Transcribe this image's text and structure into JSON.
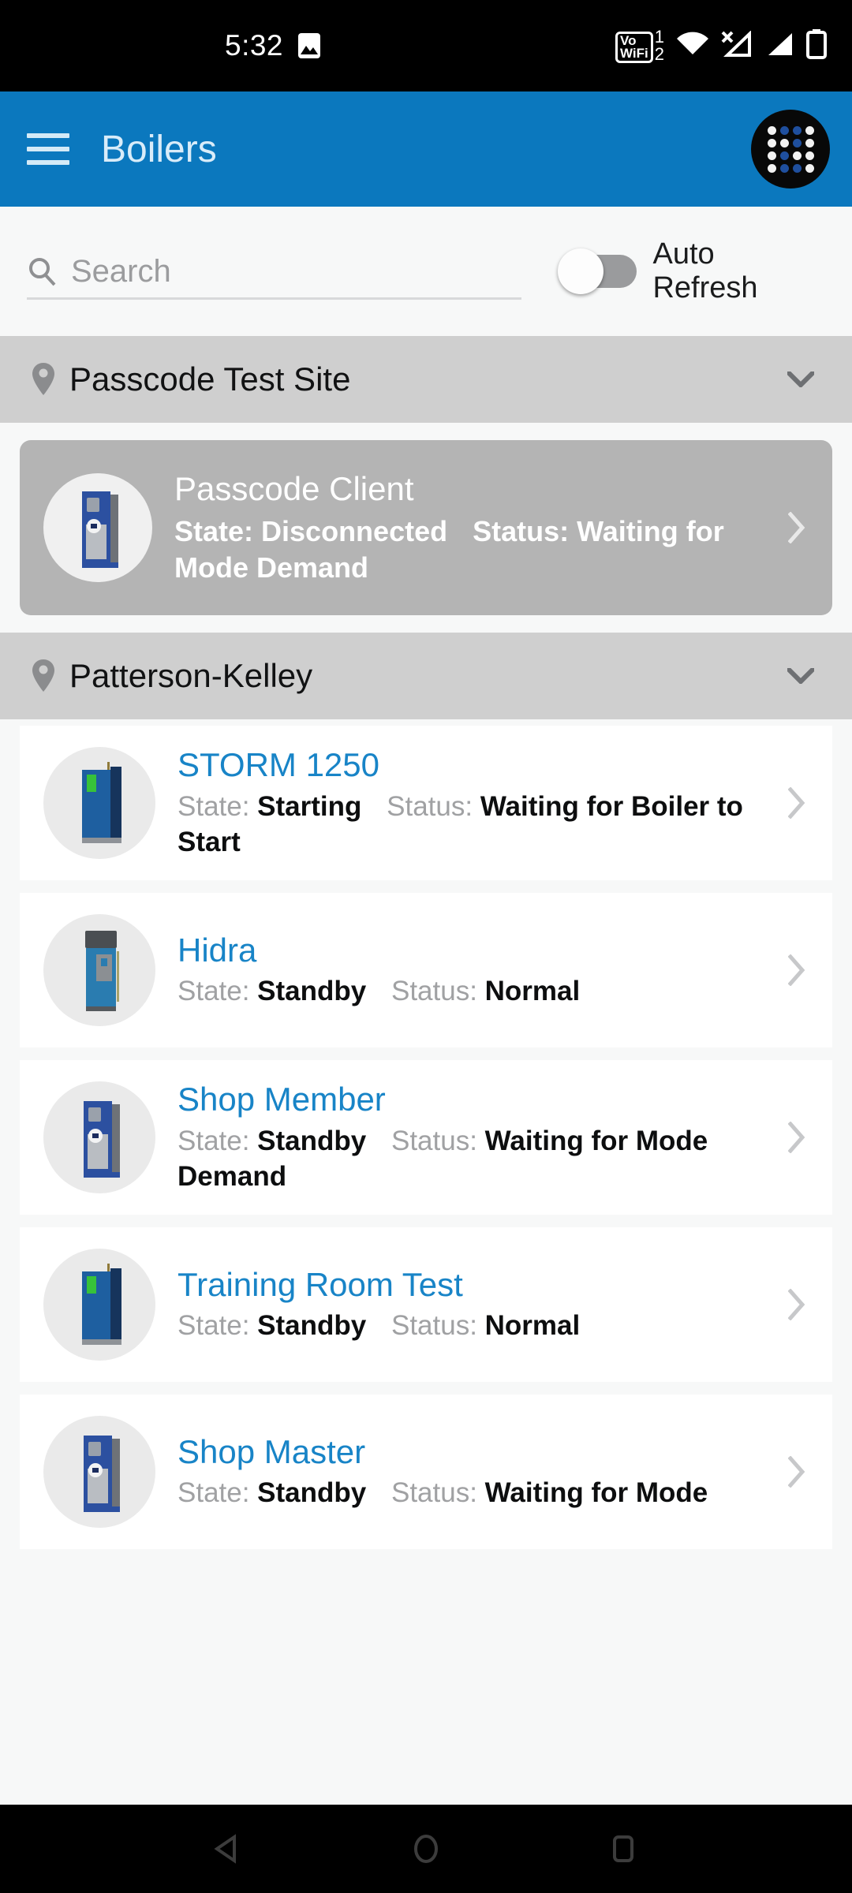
{
  "status_bar": {
    "time": "5:32",
    "screenshot_icon": "image-icon",
    "volte_line1": "Vo",
    "volte_line2": "WiFi",
    "volte_index": "1",
    "volte_index2": "2",
    "wifi_icon": "wifi-icon",
    "signal_no_service_icon": "signal-no-service-icon",
    "signal_icon": "signal-icon",
    "battery_icon": "battery-icon"
  },
  "app_bar": {
    "menu_icon": "hamburger-menu-icon",
    "title": "Boilers",
    "logo_icon": "pk-dots-logo-icon",
    "bar_color": "#0b78be",
    "title_color": "#d9ecf9",
    "logo_dots": [
      [
        "#f2f2f2",
        "#1f4f9e",
        "#1f4f9e",
        "#f2f2f2"
      ],
      [
        "#f2f2f2",
        "#f2f2f2",
        "#1f4f9e",
        "#f2f2f2"
      ],
      [
        "#f2f2f2",
        "#1f4f9e",
        "#f2f2f2",
        "#f2f2f2"
      ],
      [
        "#f2f2f2",
        "#1f4f9e",
        "#1f4f9e",
        "#f2f2f2"
      ]
    ]
  },
  "search": {
    "icon": "search-icon",
    "placeholder": "Search",
    "value": ""
  },
  "auto_refresh": {
    "label": "Auto Refresh",
    "state": "off",
    "track_color": "#9a9b9d",
    "knob_color": "#fdfdfd"
  },
  "sites": [
    {
      "name": "Passcode Test Site",
      "pin_icon": "location-pin-icon",
      "expand_icon": "chevron-down-icon",
      "expanded": true,
      "boilers": [
        {
          "name": "Passcode Client",
          "state_label": "State:",
          "state_value": "Disconnected",
          "status_label": "Status:",
          "status_value": "Waiting for Mode Demand",
          "thumb_icon": "boiler-cabinet-blue-icon",
          "chevron_icon": "chevron-right-icon",
          "selected": true
        }
      ]
    },
    {
      "name": "Patterson-Kelley",
      "pin_icon": "location-pin-icon",
      "expand_icon": "chevron-down-icon",
      "expanded": true,
      "boilers": [
        {
          "name": "STORM 1250",
          "state_label": "State:",
          "state_value": "Starting",
          "status_label": "Status:",
          "status_value": "Waiting for Boiler to Start",
          "thumb_icon": "boiler-cabinet-green-panel-icon",
          "chevron_icon": "chevron-right-icon",
          "selected": false
        },
        {
          "name": "Hidra",
          "state_label": "State:",
          "state_value": "Standby",
          "status_label": "Status:",
          "status_value": "Normal",
          "thumb_icon": "boiler-cylinder-icon",
          "chevron_icon": "chevron-right-icon",
          "selected": false
        },
        {
          "name": "Shop Member",
          "state_label": "State:",
          "state_value": "Standby",
          "status_label": "Status:",
          "status_value": "Waiting for Mode Demand",
          "thumb_icon": "boiler-cabinet-blue-icon",
          "chevron_icon": "chevron-right-icon",
          "selected": false
        },
        {
          "name": "Training Room Test",
          "state_label": "State:",
          "state_value": "Standby",
          "status_label": "Status:",
          "status_value": "Normal",
          "thumb_icon": "boiler-cabinet-green-panel-icon",
          "chevron_icon": "chevron-right-icon",
          "selected": false
        },
        {
          "name": "Shop Master",
          "state_label": "State:",
          "state_value": "Standby",
          "status_label": "Status:",
          "status_value": "Waiting for Mode",
          "thumb_icon": "boiler-cabinet-blue-icon",
          "chevron_icon": "chevron-right-icon",
          "selected": false
        }
      ]
    }
  ],
  "nav_bar": {
    "back_icon": "back-triangle-icon",
    "home_icon": "home-circle-icon",
    "recents_icon": "recents-square-icon"
  }
}
